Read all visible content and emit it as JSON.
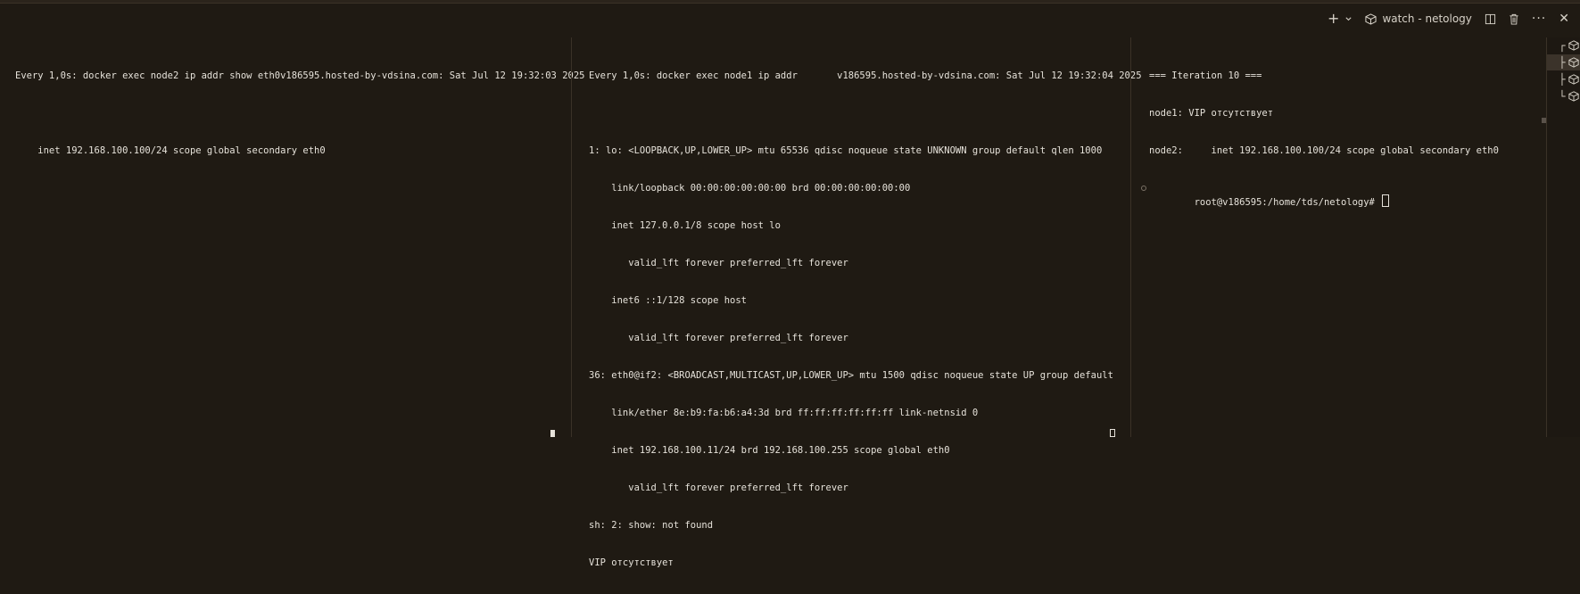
{
  "toolbar": {
    "new_terminal_icon": "plus-icon",
    "dropdown_icon": "chevron-down-icon",
    "active_terminal_label": "watch - netology",
    "active_terminal_icon": "cube-icon",
    "split_icon": "split-editor-icon",
    "kill_icon": "trash-icon",
    "more_icon": "more-icon",
    "close_icon": "close-icon"
  },
  "panes": [
    {
      "lines": [
        "Every 1,0s: docker exec node2 ip addr show eth0v186595.hosted-by-vdsina.com: Sat Jul 12 19:32:03 2025",
        "",
        "    inet 192.168.100.100/24 scope global secondary eth0"
      ]
    },
    {
      "lines": [
        "Every 1,0s: docker exec node1 ip addr       v186595.hosted-by-vdsina.com: Sat Jul 12 19:32:04 2025",
        "",
        "1: lo: <LOOPBACK,UP,LOWER_UP> mtu 65536 qdisc noqueue state UNKNOWN group default qlen 1000",
        "    link/loopback 00:00:00:00:00:00 brd 00:00:00:00:00:00",
        "    inet 127.0.0.1/8 scope host lo",
        "       valid_lft forever preferred_lft forever",
        "    inet6 ::1/128 scope host",
        "       valid_lft forever preferred_lft forever",
        "36: eth0@if2: <BROADCAST,MULTICAST,UP,LOWER_UP> mtu 1500 qdisc noqueue state UP group default",
        "    link/ether 8e:b9:fa:b6:a4:3d brd ff:ff:ff:ff:ff:ff link-netnsid 0",
        "    inet 192.168.100.11/24 brd 192.168.100.255 scope global eth0",
        "       valid_lft forever preferred_lft forever",
        "sh: 2: show: not found",
        "VIP отсутствует"
      ]
    },
    {
      "lines": [
        "=== Iteration 10 ===",
        "node1: VIP отсутствует",
        "node2:     inet 192.168.100.100/24 scope global secondary eth0"
      ],
      "prompt": "root@v186595:/home/tds/netology#"
    }
  ],
  "terminal_list": {
    "items": [
      {
        "tree": "┌",
        "icon": "cube-icon",
        "selected": false
      },
      {
        "tree": "├",
        "icon": "cube-icon",
        "selected": true
      },
      {
        "tree": "├",
        "icon": "cube-icon",
        "selected": false
      },
      {
        "tree": "└",
        "icon": "cube-icon",
        "selected": false
      }
    ]
  }
}
